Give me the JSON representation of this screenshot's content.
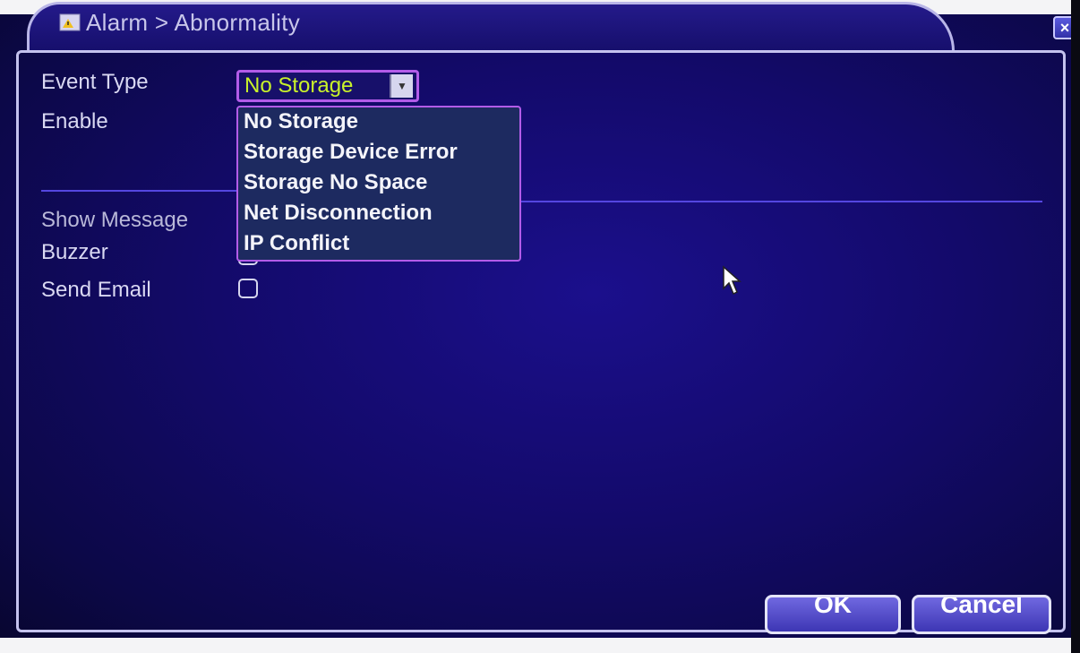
{
  "window": {
    "title": "Alarm > Abnormality",
    "close_label": "×"
  },
  "form": {
    "event_type_label": "Event Type",
    "event_type_value": "No Storage",
    "enable_label": "Enable",
    "show_message_label": "Show Message",
    "buzzer_label": "Buzzer",
    "send_email_label": "Send Email"
  },
  "dropdown": {
    "options": [
      "No Storage",
      "Storage Device Error",
      "Storage No Space",
      "Net Disconnection",
      "IP Conflict"
    ]
  },
  "buttons": {
    "ok_label": "OK",
    "cancel_label": "Cancel"
  },
  "colors": {
    "background": "#130a6a",
    "selected_value": "#c9f22a",
    "highlight_border": "#b35ce9",
    "dropdown_bg": "#1d2a60"
  }
}
